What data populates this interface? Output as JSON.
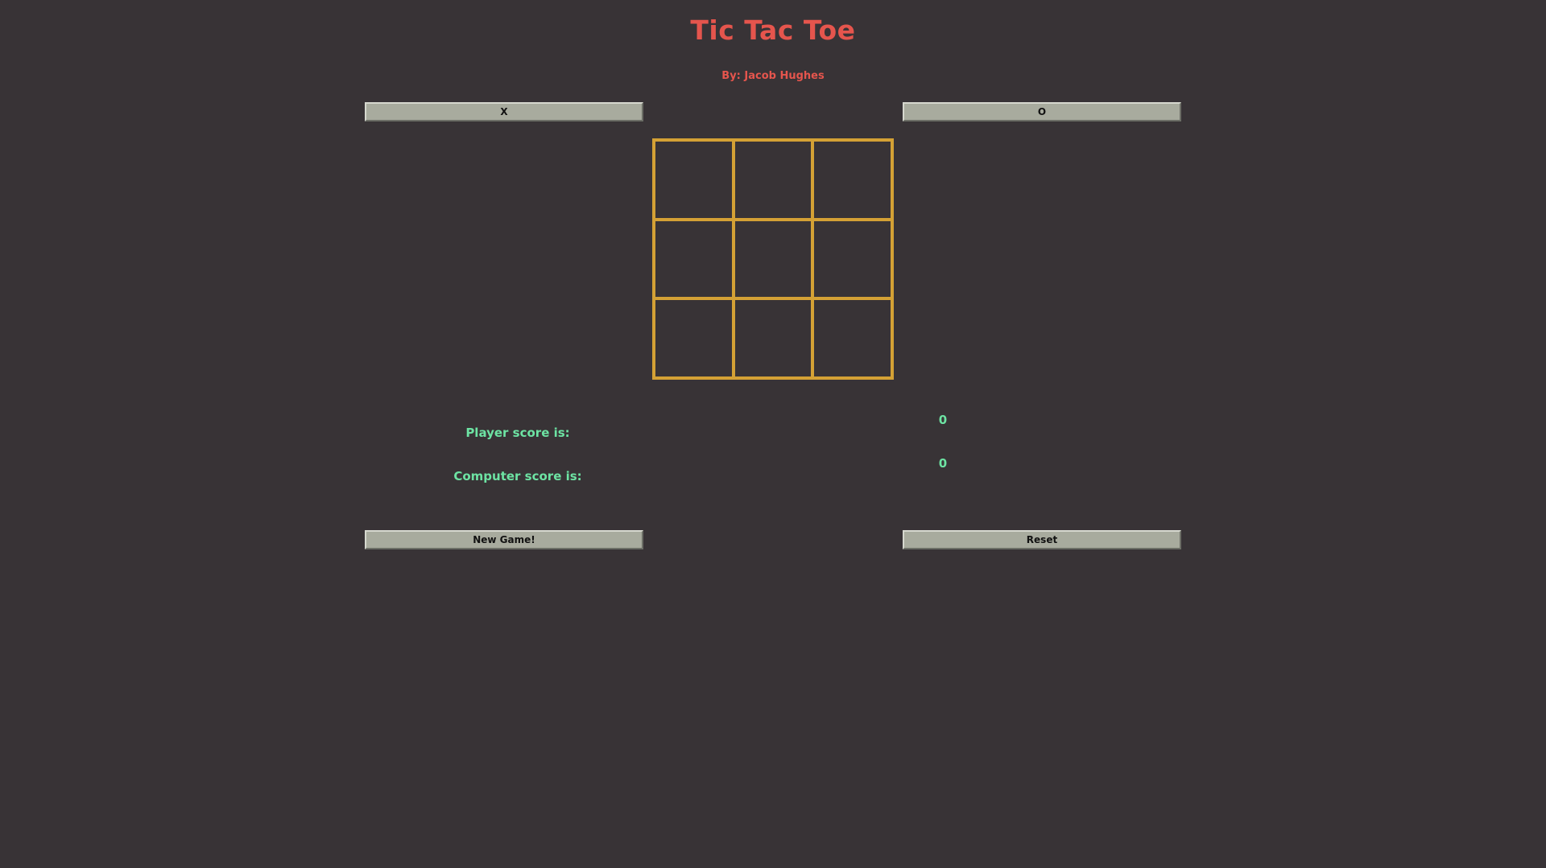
{
  "header": {
    "title": "Tic Tac Toe",
    "subtitle": "By: Jacob Hughes"
  },
  "choose": {
    "x_label": "X",
    "o_label": "O"
  },
  "board": {
    "cells": [
      "",
      "",
      "",
      "",
      "",
      "",
      "",
      "",
      ""
    ]
  },
  "scores": {
    "player_label": "Player score is:",
    "player_value": "0",
    "computer_label": "Computer score is:",
    "computer_value": "0"
  },
  "controls": {
    "new_game_label": "New Game!",
    "reset_label": "Reset"
  },
  "colors": {
    "background": "#383336",
    "title": "#e5554d",
    "board": "#d4a135",
    "score_text": "#6de3a3",
    "button": "#a8ab9e"
  }
}
